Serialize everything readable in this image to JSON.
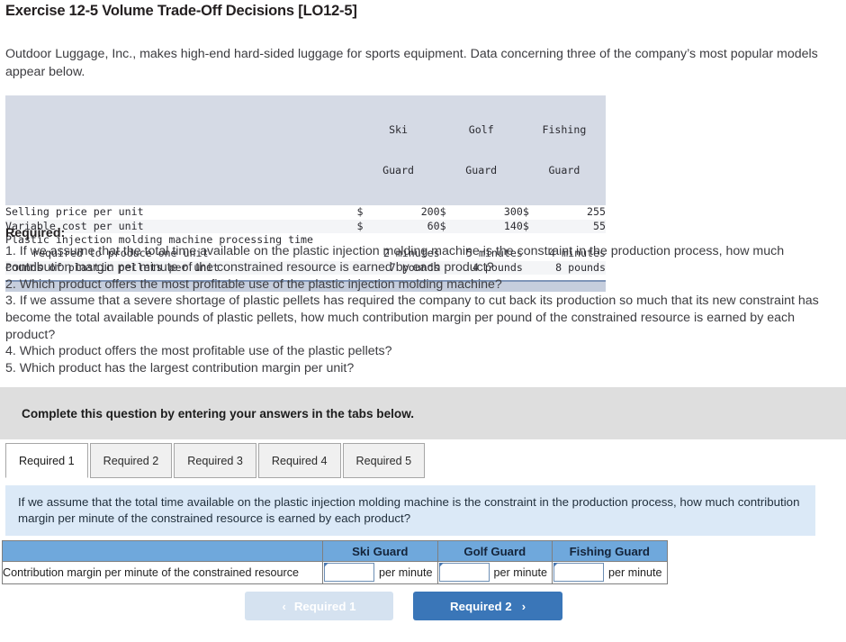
{
  "exercise": {
    "title": "Exercise 12-5 Volume Trade-Off Decisions [LO12-5]",
    "intro": "Outdoor Luggage, Inc., makes high-end hard-sided luggage for sports equipment. Data concerning three of the company’s most popular models appear below."
  },
  "data_table": {
    "blank_header": "",
    "columns": [
      {
        "line1": "Ski",
        "line2": "Guard"
      },
      {
        "line1": "Golf",
        "line2": "Guard"
      },
      {
        "line1": "Fishing",
        "line2": "Guard"
      }
    ],
    "rows": [
      {
        "label": "Selling price per unit",
        "indent": false,
        "currency": "$",
        "values": [
          "200",
          "300",
          "255"
        ],
        "units": [
          "",
          "",
          ""
        ]
      },
      {
        "label": "Variable cost per unit",
        "indent": false,
        "currency": "$",
        "values": [
          "60",
          "140",
          "55"
        ],
        "units": [
          "",
          "",
          ""
        ]
      },
      {
        "label": "Plastic injection molding machine processing time",
        "indent": false,
        "currency": "",
        "values": [
          "",
          "",
          ""
        ],
        "units": [
          "",
          "",
          ""
        ]
      },
      {
        "label": "required to produce one unit",
        "indent": true,
        "currency": "",
        "values": [
          "",
          "",
          ""
        ],
        "units": [
          "2 minutes",
          "5 minutes",
          "4 minutes"
        ]
      },
      {
        "label": "Pounds of plastic pellets per unit",
        "indent": false,
        "currency": "",
        "values": [
          "",
          "",
          ""
        ],
        "units": [
          "7 pounds",
          "4 pounds",
          "8 pounds"
        ]
      }
    ]
  },
  "required": {
    "heading": "Required:",
    "items": [
      "1. If we assume that the total time available on the plastic injection molding machine is the constraint in the production process, how much contribution margin per minute of the constrained resource is earned by each product?",
      "2. Which product offers the most profitable use of the plastic injection molding machine?",
      "3. If we assume that a severe shortage of plastic pellets has required the company to cut back its production so much that its new constraint has become the total available pounds of plastic pellets, how much contribution margin per pound of the constrained resource is earned by each product?",
      "4. Which product offers the most profitable use of the plastic pellets?",
      "5. Which product has the largest contribution margin per unit?"
    ]
  },
  "instruction_banner": {
    "text": "Complete this question by entering your answers in the tabs below."
  },
  "tabs": [
    {
      "label": "Required 1",
      "active": true
    },
    {
      "label": "Required 2",
      "active": false
    },
    {
      "label": "Required 3",
      "active": false
    },
    {
      "label": "Required 4",
      "active": false
    },
    {
      "label": "Required 5",
      "active": false
    }
  ],
  "question_panel": {
    "text": "If we assume that the total time available on the plastic injection molding machine is the constraint in the production process, how much contribution margin per minute of the constrained resource is earned by each product?"
  },
  "answer_table": {
    "label_header": "",
    "headers": [
      "Ski Guard",
      "Golf Guard",
      "Fishing Guard"
    ],
    "row_label": "Contribution margin per minute of the constrained resource",
    "cells": [
      {
        "value": "",
        "placeholder": "",
        "unit": "per minute"
      },
      {
        "value": "",
        "placeholder": "",
        "unit": "per minute"
      },
      {
        "value": "",
        "placeholder": "",
        "unit": "per minute"
      }
    ]
  },
  "navigation": {
    "prev_label": "Required 1",
    "prev_chevron": "‹",
    "next_label": "Required 2",
    "next_chevron": "›"
  },
  "colors": {
    "data_header_bg": "#d5dae5",
    "data_footer_bg": "#c6cedd",
    "data_footer_border": "#7f95b8",
    "banner_bg": "#dedede",
    "question_panel_bg": "#dbe9f7",
    "answer_header_bg": "#6fa8dc",
    "next_button_bg": "#3a76b8",
    "prev_button_bg": "#d5e2f0"
  }
}
